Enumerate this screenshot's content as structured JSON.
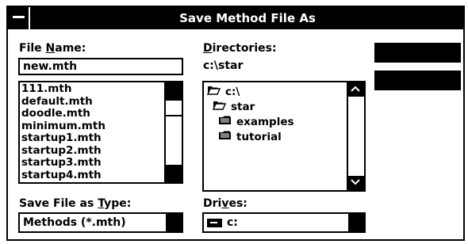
{
  "window": {
    "title": "Save Method File As"
  },
  "file_name": {
    "label_pre": "File ",
    "label_accel": "N",
    "label_post": "ame:",
    "value": "new.mth",
    "files": [
      "111.mth",
      "default.mth",
      "doodle.mth",
      "minimum.mth",
      "startup1.mth",
      "startup2.mth",
      "startup3.mth",
      "startup4.mth"
    ]
  },
  "directories": {
    "label_accel": "D",
    "label_post": "irectories:",
    "current_path": "c:\\star",
    "tree": [
      {
        "name": "c:\\",
        "icon": "open-folder-icon",
        "level": 0
      },
      {
        "name": "star",
        "icon": "open-folder-icon",
        "level": 1
      },
      {
        "name": "examples",
        "icon": "closed-folder-icon",
        "level": 2
      },
      {
        "name": "tutorial",
        "icon": "closed-folder-icon",
        "level": 2
      }
    ]
  },
  "save_type": {
    "label_pre": "Save File as ",
    "label_accel": "T",
    "label_post": "ype:",
    "selected": "Methods (*.mth)"
  },
  "drives": {
    "label_pre": "Dri",
    "label_accel": "v",
    "label_post": "es:",
    "selected": "c:"
  },
  "buttons": {
    "ok_label": "",
    "cancel_label": ""
  }
}
